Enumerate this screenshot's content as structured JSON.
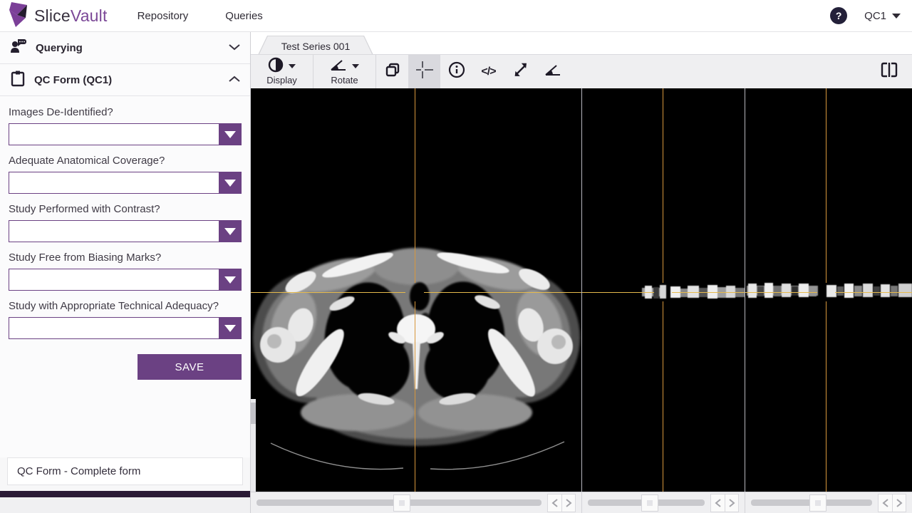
{
  "nav": {
    "brand": {
      "name_part1": "Slice",
      "name_part2": "Vault"
    },
    "items": [
      {
        "label": "Repository"
      },
      {
        "label": "Queries"
      }
    ],
    "help_glyph": "?",
    "user": {
      "label": "QC1"
    }
  },
  "sidebar": {
    "sections": [
      {
        "label": "Querying",
        "icon": "person-chat-icon",
        "state": "collapsed"
      },
      {
        "label": "QC Form (QC1)",
        "icon": "clipboard-icon",
        "state": "expanded"
      }
    ],
    "form": {
      "fields": [
        {
          "label": "Images De-Identified?",
          "value": ""
        },
        {
          "label": "Adequate Anatomical Coverage?",
          "value": ""
        },
        {
          "label": "Study Performed with Contrast?",
          "value": ""
        },
        {
          "label": "Study Free from Biasing Marks?",
          "value": ""
        },
        {
          "label": "Study with Appropriate Technical Adequacy?",
          "value": ""
        }
      ],
      "save_label": "SAVE"
    },
    "footer_note": "QC Form - Complete form"
  },
  "main": {
    "tab": {
      "label": "Test Series 001"
    },
    "toolbar": {
      "display_label": "Display",
      "rotate_label": "Rotate",
      "code_icon_text": "</>",
      "icons": [
        "contrast-icon",
        "rotate-angle-icon",
        "copy-layers-icon",
        "crosshair-icon",
        "info-icon",
        "code-icon",
        "expand-diagonal-icon",
        "angle-icon",
        "split-view-icon"
      ],
      "active_tool": "crosshair"
    },
    "viewer": {
      "viewports": 3,
      "modality": "CT axial slice with MPR strips",
      "crosshair_color_vertical": "#d7973c",
      "crosshair_color_horizontal": "#e6ba4c"
    }
  },
  "colors": {
    "accent_purple": "#6b4183",
    "brand_purple": "#7b4897",
    "dark_bar": "#2a1a36",
    "help_badge": "#232039",
    "toolbar_bg": "#efeff1"
  }
}
